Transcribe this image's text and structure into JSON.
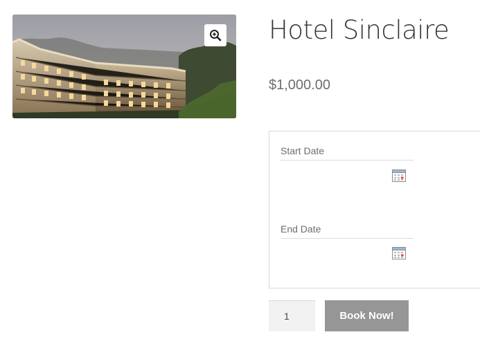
{
  "product": {
    "title": "Hotel Sinclaire",
    "price": "$1,000.00",
    "image_icon": "hotel-photo",
    "zoom_icon": "magnifier-plus-icon"
  },
  "booking": {
    "start_label": "Start Date",
    "end_label": "End Date",
    "calendar_icon": "calendar-icon"
  },
  "cart": {
    "quantity": "1",
    "book_label": "Book Now!"
  },
  "colors": {
    "button_bg": "#969696",
    "qty_bg": "#f2f2f2",
    "title_color": "#333333",
    "price_color": "#6d6d6d",
    "border": "#d8d8d8"
  }
}
